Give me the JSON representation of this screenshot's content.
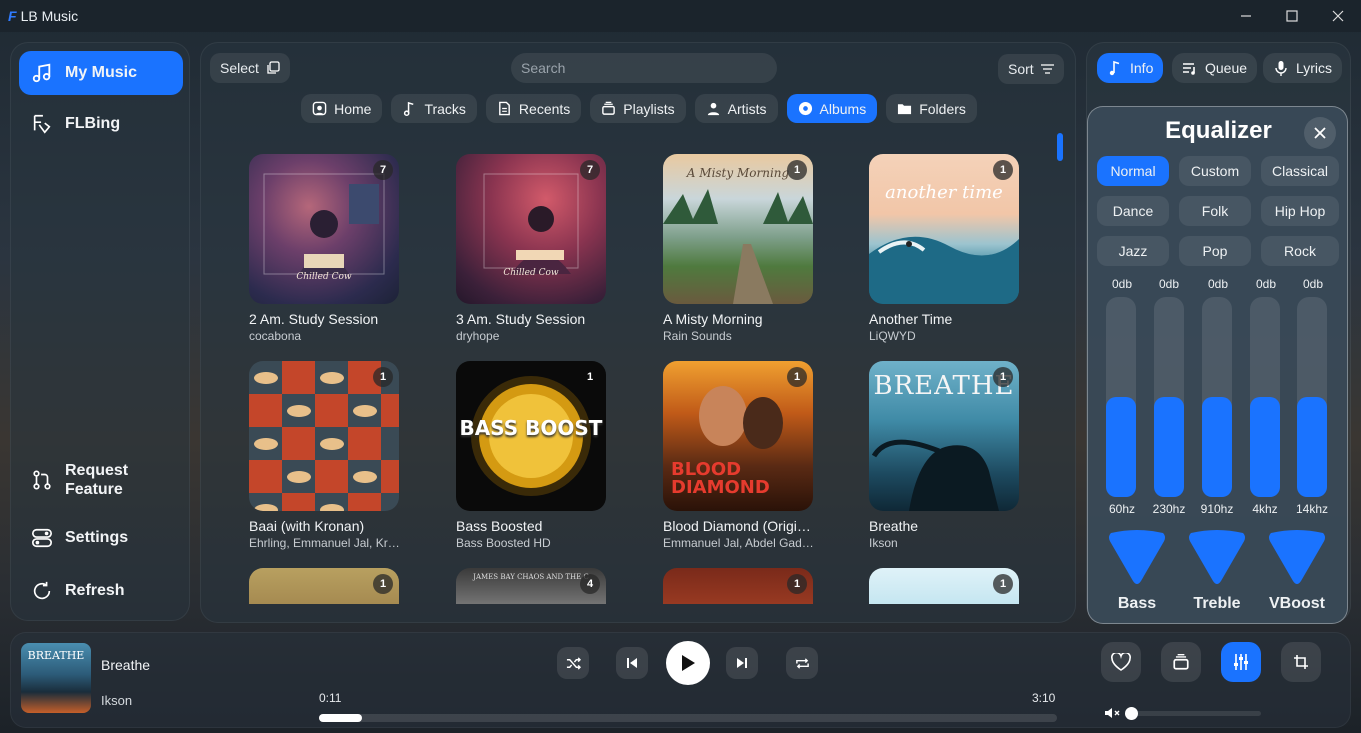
{
  "window": {
    "logo": "F",
    "title": "LB Music"
  },
  "sidebar": {
    "items": [
      {
        "label": "My Music",
        "icon": "music-note-icon"
      },
      {
        "label": "FLBing",
        "icon": "flbing-icon"
      }
    ],
    "bottom_items": [
      {
        "label": "Request Feature",
        "icon": "pull-request-icon"
      },
      {
        "label": "Settings",
        "icon": "toggles-icon"
      },
      {
        "label": "Refresh",
        "icon": "refresh-icon"
      }
    ]
  },
  "toolbar": {
    "select_label": "Select",
    "search_placeholder": "Search",
    "sort_label": "Sort"
  },
  "tabs": [
    {
      "label": "Home",
      "icon": "home-icon"
    },
    {
      "label": "Tracks",
      "icon": "music-note-icon"
    },
    {
      "label": "Recents",
      "icon": "document-icon"
    },
    {
      "label": "Playlists",
      "icon": "stack-icon"
    },
    {
      "label": "Artists",
      "icon": "person-icon"
    },
    {
      "label": "Albums",
      "icon": "disc-icon",
      "active": true
    },
    {
      "label": "Folders",
      "icon": "folder-icon"
    }
  ],
  "albums": [
    {
      "title": "2 Am. Study Session",
      "artist": "cocabona",
      "count": "7"
    },
    {
      "title": "3 Am. Study Session",
      "artist": "dryhope",
      "count": "7"
    },
    {
      "title": "A Misty Morning",
      "artist": "Rain Sounds",
      "count": "1"
    },
    {
      "title": "Another Time",
      "artist": "LiQWYD",
      "count": "1"
    },
    {
      "title": "Baai (with Kronan)",
      "artist": "Ehrling, Emmanuel Jal, Kr…",
      "count": "1"
    },
    {
      "title": "Bass Boosted",
      "artist": "Bass Boosted HD",
      "count": "1"
    },
    {
      "title": "Blood Diamond (Origi…",
      "artist": "Emmanuel Jal, Abdel Gad…",
      "count": "1"
    },
    {
      "title": "Breathe",
      "artist": "Ikson",
      "count": "1"
    },
    {
      "title": "",
      "artist": "",
      "count": "1"
    },
    {
      "title": "",
      "artist": "",
      "count": "4"
    },
    {
      "title": "",
      "artist": "",
      "count": "1"
    },
    {
      "title": "",
      "artist": "",
      "count": "1"
    }
  ],
  "cover_text": {
    "misty": "A Misty Morning",
    "another": "another time",
    "bass": "BASS BOOST",
    "blood1": "BLOOD",
    "blood2": "DIAMOND",
    "breathe": "BREATHE",
    "study": "Chilled Cow",
    "james": "JAMES BAY CHAOS AND THE C"
  },
  "right_tabs": [
    {
      "label": "Info",
      "icon": "music-note-icon",
      "active": true
    },
    {
      "label": "Queue",
      "icon": "queue-icon"
    },
    {
      "label": "Lyrics",
      "icon": "microphone-icon"
    }
  ],
  "equalizer": {
    "title": "Equalizer",
    "presets": [
      "Normal",
      "Custom",
      "Classical",
      "Dance",
      "Folk",
      "Hip Hop",
      "Jazz",
      "Pop",
      "Rock"
    ],
    "active_preset": "Normal",
    "bands": [
      {
        "db": "0db",
        "freq": "60hz",
        "level": 0.5
      },
      {
        "db": "0db",
        "freq": "230hz",
        "level": 0.5
      },
      {
        "db": "0db",
        "freq": "910hz",
        "level": 0.5
      },
      {
        "db": "0db",
        "freq": "4khz",
        "level": 0.5
      },
      {
        "db": "0db",
        "freq": "14khz",
        "level": 0.5
      }
    ],
    "knobs": [
      "Bass",
      "Treble",
      "VBoost"
    ]
  },
  "player": {
    "cover_text": "BREATHE",
    "title": "Breathe",
    "artist": "Ikson",
    "elapsed": "0:11",
    "duration": "3:10",
    "progress": 0.058,
    "volume": 0.0
  },
  "colors": {
    "accent": "#1a73ff"
  }
}
